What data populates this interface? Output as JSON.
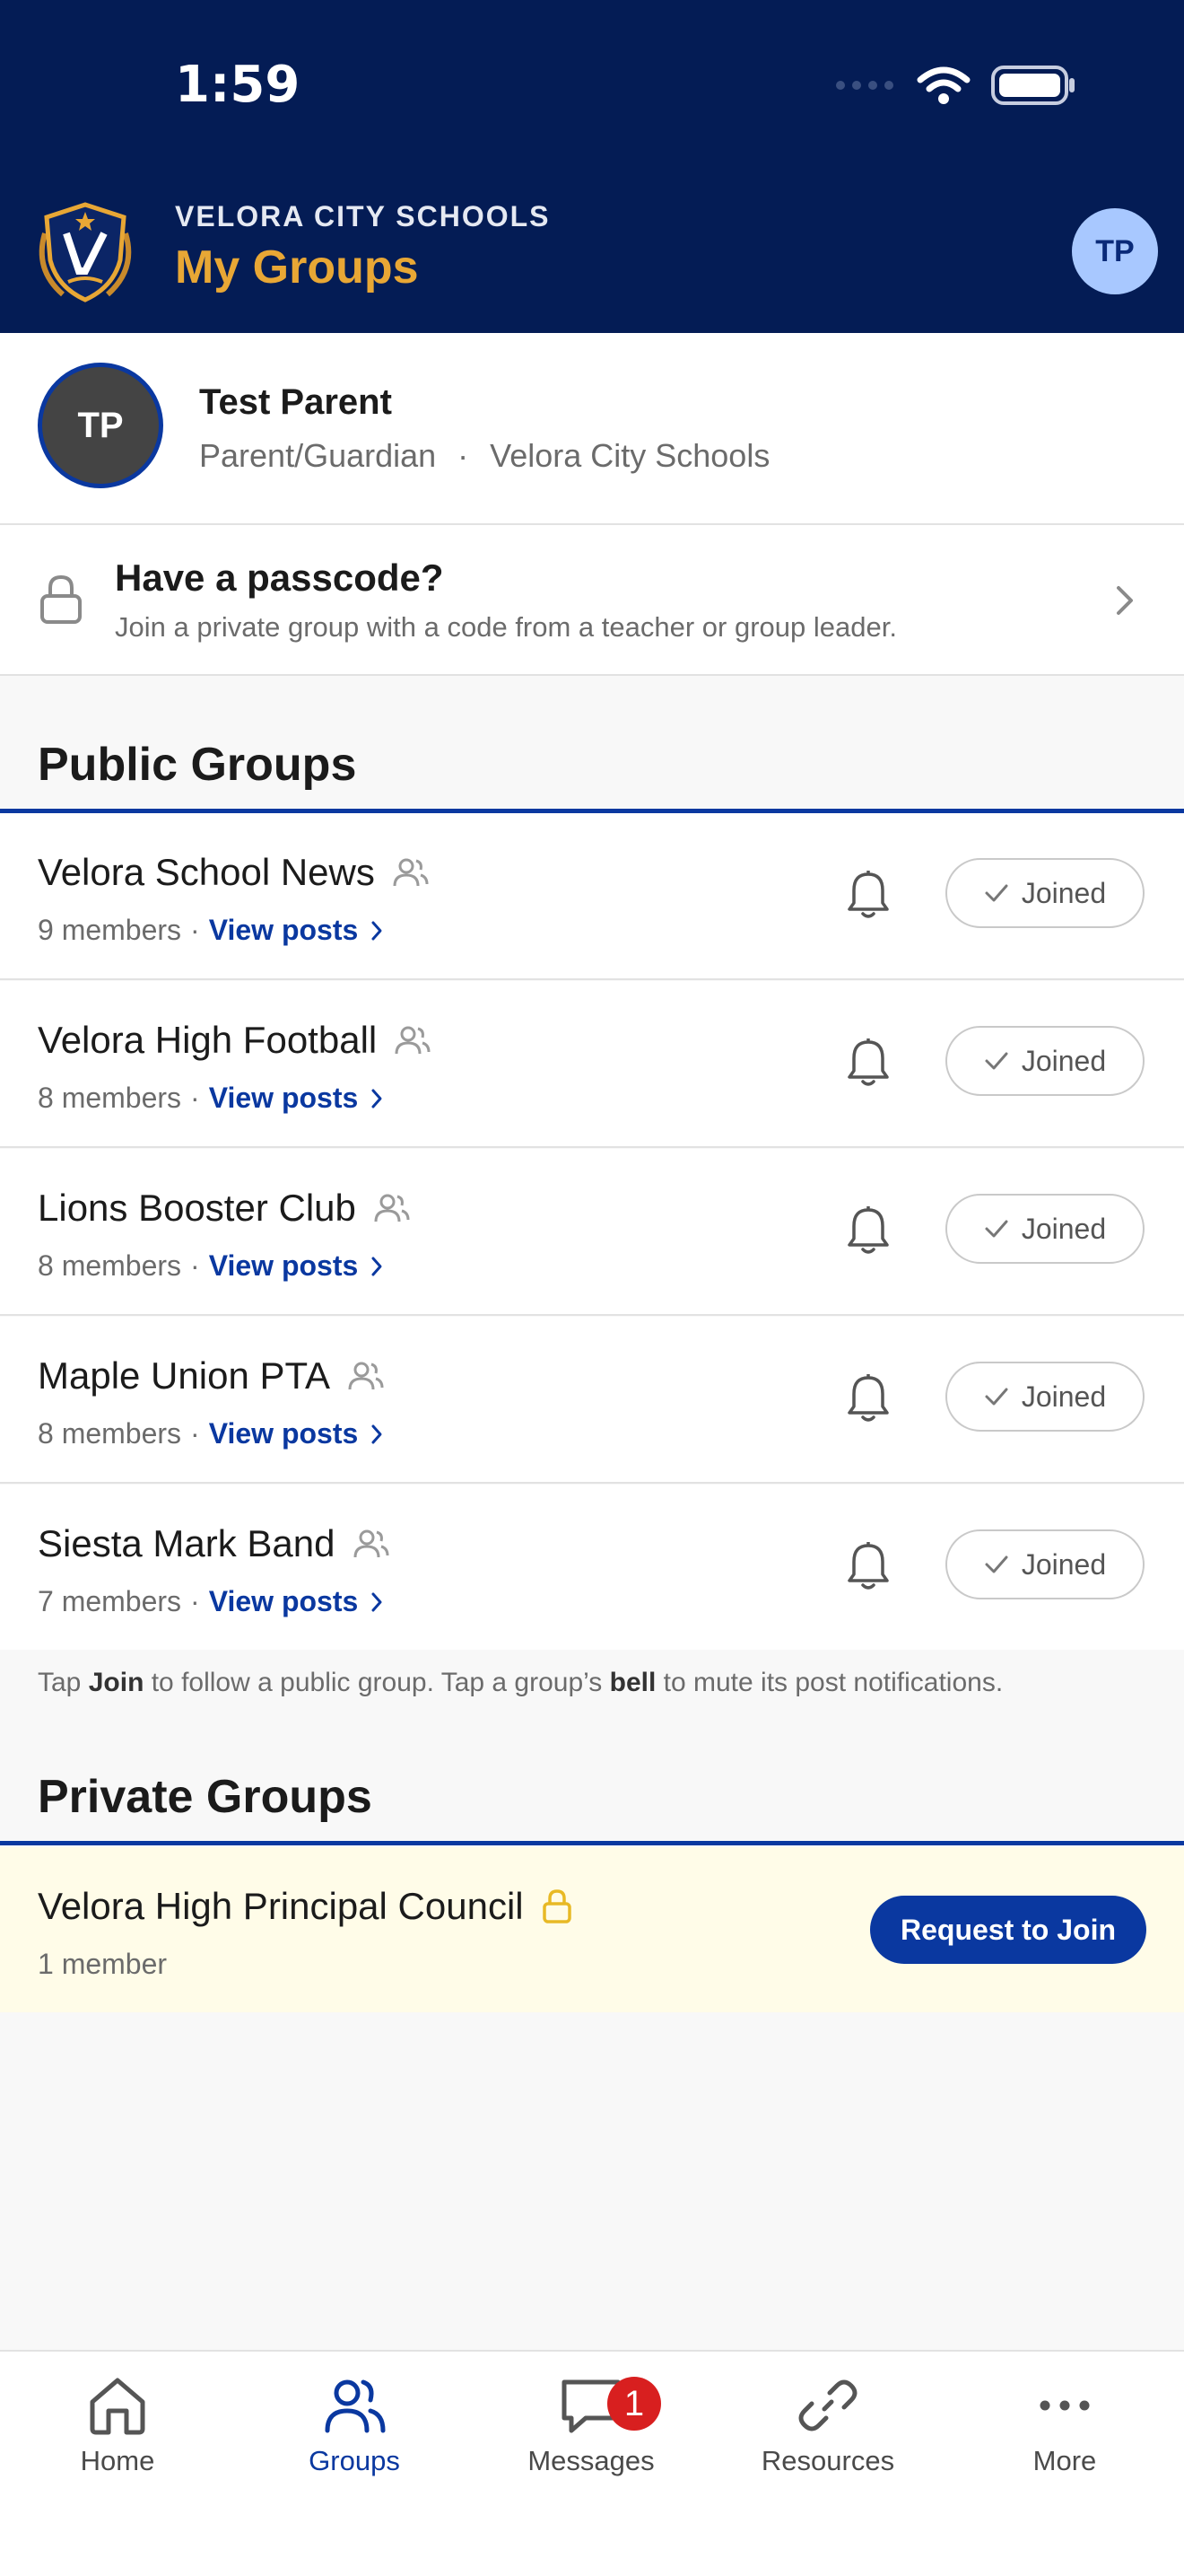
{
  "status_bar": {
    "time": "1:59"
  },
  "header": {
    "district": "VELORA CITY SCHOOLS",
    "title": "My Groups",
    "avatar_initials": "TP",
    "colors": {
      "background": "#041c55",
      "title": "#e8a735"
    }
  },
  "profile": {
    "initials": "TP",
    "name": "Test Parent",
    "role": "Parent/Guardian",
    "separator": "·",
    "district": "Velora City Schools"
  },
  "passcode": {
    "title": "Have a passcode?",
    "subtitle": "Join a private group with a code from a teacher or group leader."
  },
  "public_groups": {
    "title": "Public Groups",
    "groups": [
      {
        "name": "Velora School News",
        "members": "9 members",
        "sep": "·",
        "view_posts": "View posts",
        "status": "Joined"
      },
      {
        "name": "Velora High Football",
        "members": "8 members",
        "sep": "·",
        "view_posts": "View posts",
        "status": "Joined"
      },
      {
        "name": "Lions Booster Club",
        "members": "8 members",
        "sep": "·",
        "view_posts": "View posts",
        "status": "Joined"
      },
      {
        "name": "Maple Union PTA",
        "members": "8 members",
        "sep": "·",
        "view_posts": "View posts",
        "status": "Joined"
      },
      {
        "name": "Siesta Mark Band",
        "members": "7 members",
        "sep": "·",
        "view_posts": "View posts",
        "status": "Joined"
      }
    ],
    "hint_parts": [
      "Tap ",
      "Join",
      " to follow a public group. Tap a group’s ",
      "bell",
      " to mute its post notifications."
    ]
  },
  "private_groups": {
    "title": "Private Groups",
    "groups": [
      {
        "name": "Velora High Principal Council",
        "members": "1 member",
        "action": "Request to Join"
      }
    ]
  },
  "tabbar": {
    "tabs": [
      {
        "label": "Home",
        "icon": "home-icon"
      },
      {
        "label": "Groups",
        "icon": "groups-icon",
        "active": true
      },
      {
        "label": "Messages",
        "icon": "messages-icon",
        "badge": "1"
      },
      {
        "label": "Resources",
        "icon": "link-icon"
      },
      {
        "label": "More",
        "icon": "more-icon"
      }
    ]
  },
  "colors": {
    "accent": "#0a38a0",
    "badge": "#d81f1f",
    "private_bg": "#fffce8"
  }
}
